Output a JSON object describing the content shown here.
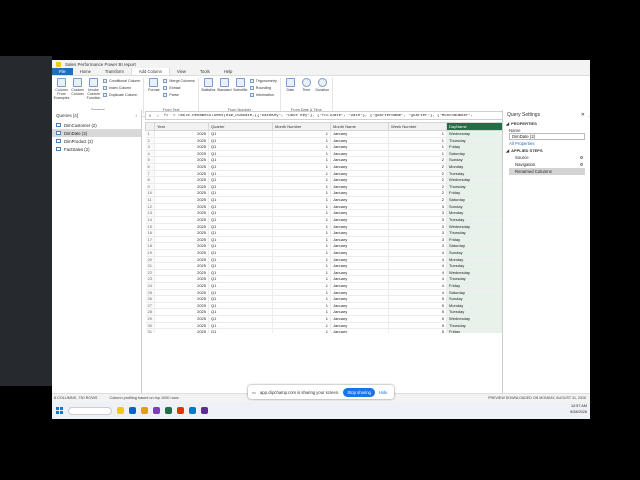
{
  "window": {
    "title": "Sales Performance Power BI report"
  },
  "menu": {
    "tabs": [
      "File",
      "Home",
      "Transform",
      "Add Column",
      "View",
      "Tools",
      "Help"
    ],
    "active": "Add Column"
  },
  "ribbon": {
    "general": {
      "label": "General",
      "buttons": [
        "Column From Examples",
        "Custom Column",
        "Invoke Custom Function"
      ],
      "small": [
        "Conditional Column",
        "Index Column",
        "Duplicate Column"
      ]
    },
    "from_text": {
      "label": "From Text",
      "buttons": [
        "Format"
      ],
      "small": [
        "Merge Columns",
        "Extract",
        "Parse"
      ]
    },
    "from_number": {
      "label": "From Number",
      "buttons": [
        "Statistics",
        "Standard",
        "Scientific"
      ],
      "small": [
        "Trigonometry",
        "Rounding",
        "Information"
      ]
    },
    "from_date_time": {
      "label": "From Date & Time",
      "buttons": [
        "Date",
        "Time",
        "Duration"
      ]
    }
  },
  "formula_bar": {
    "fx": "fx",
    "text": "= Table.RenameColumns(dim_DimDate,{{\"DateKey\", \"Date Key\"}, {\"FullDate\", \"Date\"}, {\"QuarterName\", \"Quarter\"}, {\"MonthNumber\","
  },
  "queries": {
    "header": "Queries [4]",
    "items": [
      "DimCustomer (2)",
      "DimDate (2)",
      "DimProduct (2)",
      "FactSales (2)"
    ],
    "selected": 1
  },
  "grid": {
    "columns": [
      "Year",
      "Quarter",
      "Month Number",
      "Month Name",
      "Week Number",
      "DayName"
    ],
    "selected_column": 5,
    "rows": [
      [
        "1",
        "2025",
        "Q1",
        "1",
        "January",
        "1",
        "Wednesday"
      ],
      [
        "2",
        "2025",
        "Q1",
        "1",
        "January",
        "1",
        "Thursday"
      ],
      [
        "3",
        "2025",
        "Q1",
        "1",
        "January",
        "1",
        "Friday"
      ],
      [
        "4",
        "2025",
        "Q1",
        "1",
        "January",
        "1",
        "Saturday"
      ],
      [
        "5",
        "2025",
        "Q1",
        "1",
        "January",
        "2",
        "Sunday"
      ],
      [
        "6",
        "2025",
        "Q1",
        "1",
        "January",
        "2",
        "Monday"
      ],
      [
        "7",
        "2025",
        "Q1",
        "1",
        "January",
        "2",
        "Tuesday"
      ],
      [
        "8",
        "2025",
        "Q1",
        "1",
        "January",
        "2",
        "Wednesday"
      ],
      [
        "9",
        "2025",
        "Q1",
        "1",
        "January",
        "2",
        "Thursday"
      ],
      [
        "10",
        "2025",
        "Q1",
        "1",
        "January",
        "2",
        "Friday"
      ],
      [
        "11",
        "2025",
        "Q1",
        "1",
        "January",
        "2",
        "Saturday"
      ],
      [
        "12",
        "2025",
        "Q1",
        "1",
        "January",
        "3",
        "Sunday"
      ],
      [
        "13",
        "2025",
        "Q1",
        "1",
        "January",
        "3",
        "Monday"
      ],
      [
        "14",
        "2025",
        "Q1",
        "1",
        "January",
        "3",
        "Tuesday"
      ],
      [
        "15",
        "2025",
        "Q1",
        "1",
        "January",
        "3",
        "Wednesday"
      ],
      [
        "16",
        "2025",
        "Q1",
        "1",
        "January",
        "3",
        "Thursday"
      ],
      [
        "17",
        "2025",
        "Q1",
        "1",
        "January",
        "3",
        "Friday"
      ],
      [
        "18",
        "2025",
        "Q1",
        "1",
        "January",
        "3",
        "Saturday"
      ],
      [
        "19",
        "2025",
        "Q1",
        "1",
        "January",
        "4",
        "Sunday"
      ],
      [
        "20",
        "2025",
        "Q1",
        "1",
        "January",
        "4",
        "Monday"
      ],
      [
        "21",
        "2025",
        "Q1",
        "1",
        "January",
        "4",
        "Tuesday"
      ],
      [
        "22",
        "2025",
        "Q1",
        "1",
        "January",
        "4",
        "Wednesday"
      ],
      [
        "23",
        "2025",
        "Q1",
        "1",
        "January",
        "4",
        "Thursday"
      ],
      [
        "24",
        "2025",
        "Q1",
        "1",
        "January",
        "4",
        "Friday"
      ],
      [
        "25",
        "2025",
        "Q1",
        "1",
        "January",
        "4",
        "Saturday"
      ],
      [
        "26",
        "2025",
        "Q1",
        "1",
        "January",
        "5",
        "Sunday"
      ],
      [
        "27",
        "2025",
        "Q1",
        "1",
        "January",
        "5",
        "Monday"
      ],
      [
        "28",
        "2025",
        "Q1",
        "1",
        "January",
        "5",
        "Tuesday"
      ],
      [
        "29",
        "2025",
        "Q1",
        "1",
        "January",
        "5",
        "Wednesday"
      ],
      [
        "30",
        "2025",
        "Q1",
        "1",
        "January",
        "5",
        "Thursday"
      ],
      [
        "31",
        "2025",
        "Q1",
        "1",
        "January",
        "5",
        "Friday"
      ],
      [
        "32",
        "2025",
        "Q1",
        "2",
        "February",
        "5",
        "Saturday"
      ],
      [
        "33",
        "2025",
        "Q1",
        "2",
        "February",
        "6",
        "Sunday"
      ],
      [
        "34",
        "2025",
        "Q1",
        "2",
        "February",
        "6",
        "Monday"
      ],
      [
        "35",
        "2025",
        "Q1",
        "2",
        "February",
        "6",
        "Tuesday"
      ]
    ]
  },
  "settings": {
    "header": "Query Settings",
    "properties": "PROPERTIES",
    "name_label": "Name",
    "name_value": "DimDate (2)",
    "all_properties": "All Properties",
    "applied_steps": "APPLIED STEPS",
    "steps": [
      "Source",
      "Navigation",
      "Renamed Columns"
    ],
    "selected_step": 2
  },
  "status": {
    "left": "8 COLUMNS, 730 ROWS",
    "profiling": "Column profiling based on top 1000 rows",
    "right": "PREVIEW DOWNLOADED ON MONDAY, AUGUST 31, 2026"
  },
  "share_bar": {
    "text": "app.clipchamp.com is sharing your screen.",
    "stop": "Stop sharing",
    "hide": "Hide"
  },
  "taskbar": {
    "time": "12:57 AM",
    "date": "9/28/2026"
  },
  "colors": {
    "accent": "#1f6fbf",
    "selected_col": "#1e7145",
    "share_btn": "#1a73e8"
  }
}
